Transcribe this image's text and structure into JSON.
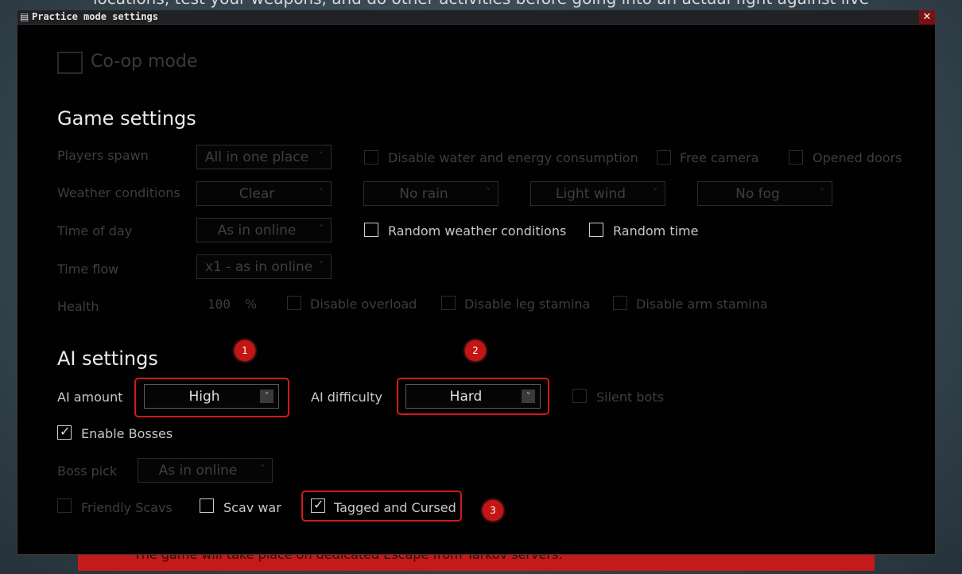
{
  "background": {
    "top_text": "locations, test your weapons, and do other activities before going into an actual fight against live",
    "bottom_text": "The game will take place on dedicated Escape from Tarkov servers."
  },
  "window": {
    "title": "Practice mode settings",
    "close_glyph": "✕"
  },
  "coop": {
    "label": "Co-op mode"
  },
  "game_settings": {
    "heading": "Game settings",
    "players_spawn": {
      "label": "Players spawn",
      "value": "All in one place"
    },
    "disable_water": "Disable water and energy consumption",
    "free_camera": "Free camera",
    "opened_doors": "Opened doors",
    "weather": {
      "label": "Weather conditions",
      "clouds": "Clear",
      "rain": "No rain",
      "wind": "Light wind",
      "fog": "No fog"
    },
    "time_of_day": {
      "label": "Time of day",
      "value": "As in online"
    },
    "random_weather": "Random weather conditions",
    "random_time": "Random time",
    "time_flow": {
      "label": "Time flow",
      "value": "x1 - as in online"
    },
    "health": {
      "label": "Health",
      "value": "100",
      "unit": "%"
    },
    "disable_overload": "Disable overload",
    "disable_leg_stamina": "Disable leg stamina",
    "disable_arm_stamina": "Disable arm stamina"
  },
  "ai_settings": {
    "heading": "AI settings",
    "ai_amount": {
      "label": "AI amount",
      "value": "High"
    },
    "ai_difficulty": {
      "label": "AI difficulty",
      "value": "Hard"
    },
    "silent_bots": "Silent bots",
    "enable_bosses": {
      "label": "Enable Bosses",
      "checked": true
    },
    "boss_pick": {
      "label": "Boss pick",
      "value": "As in online"
    },
    "friendly_scavs": "Friendly Scavs",
    "scav_war": "Scav war",
    "tagged_cursed": {
      "label": "Tagged and Cursed",
      "checked": true
    }
  },
  "badges": [
    "1",
    "2",
    "3"
  ],
  "icons": {
    "chevron": "˅",
    "check": "✓",
    "title_icon": "▤"
  },
  "colors": {
    "highlight": "#d11a1a",
    "badge": "#c41414"
  }
}
